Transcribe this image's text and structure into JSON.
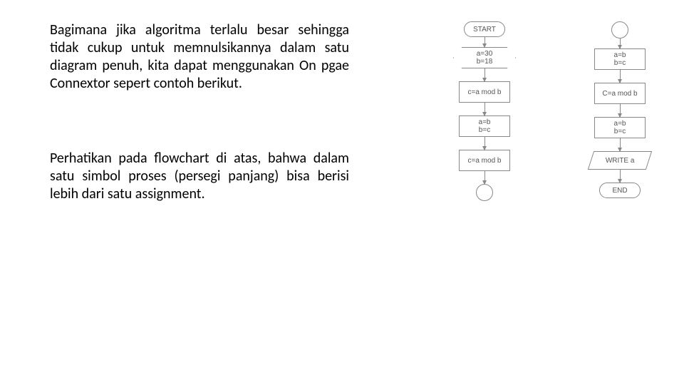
{
  "text": {
    "para1": "Bagimana jika algoritma terlalu besar sehingga tidak cukup untuk memnulsikannya dalam satu diagram penuh, kita dapat menggunakan On pgae Connextor sepert contoh berikut.",
    "para2": "Perhatikan pada flowchart di atas, bahwa dalam satu simbol proses (persegi panjang) bisa berisi lebih dari satu assignment."
  },
  "flowchart_left": {
    "start": "START",
    "n1_l1": "a=30",
    "n1_l2": "b=18",
    "n2": "c=a mod b",
    "n3_l1": "a=b",
    "n3_l2": "b=c",
    "n4": "c=a mod b"
  },
  "flowchart_right": {
    "n1_l1": "a=b",
    "n1_l2": "b=c",
    "n2": "C=a mod b",
    "n3_l1": "a=b",
    "n3_l2": "b=c",
    "io": "WRITE a",
    "end": "END"
  }
}
